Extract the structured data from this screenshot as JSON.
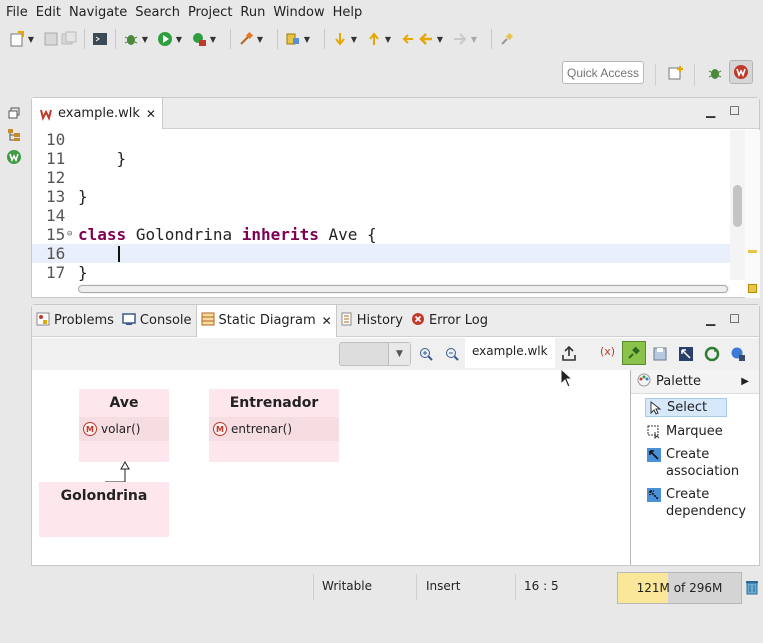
{
  "menu": [
    "File",
    "Edit",
    "Navigate",
    "Search",
    "Project",
    "Run",
    "Window",
    "Help"
  ],
  "toolbar": {
    "icons": [
      "new-icon",
      "save-icon",
      "save-all-icon",
      "terminal-icon",
      "debug-icon",
      "run-icon",
      "external-tools-icon",
      "hammer-icon",
      "open-type-icon",
      "next-annotation-icon",
      "prev-annotation-icon",
      "last-edit-icon",
      "back-icon",
      "forward-icon",
      "pin-icon"
    ]
  },
  "quick_access": {
    "placeholder": "Quick Access"
  },
  "editor": {
    "tab_title": "example.wlk",
    "lines": [
      {
        "num": "10",
        "text": ""
      },
      {
        "num": "11",
        "text": "    }"
      },
      {
        "num": "12",
        "text": ""
      },
      {
        "num": "13",
        "text": "}"
      },
      {
        "num": "14",
        "text": ""
      },
      {
        "num": "15",
        "text": "class Golondrina inherits Ave {"
      },
      {
        "num": "16",
        "text": ""
      },
      {
        "num": "17",
        "text": "}"
      }
    ],
    "keywords": [
      "class",
      "inherits"
    ]
  },
  "bottom": {
    "tabs": [
      {
        "label": "Problems",
        "icon": "problems-icon"
      },
      {
        "label": "Console",
        "icon": "console-icon"
      },
      {
        "label": "Static Diagram",
        "icon": "diagram-icon",
        "active": true
      },
      {
        "label": "History",
        "icon": "history-icon"
      },
      {
        "label": "Error Log",
        "icon": "error-log-icon"
      }
    ],
    "diagram_file": "example.wlk"
  },
  "diagram": {
    "classes": [
      {
        "name": "Ave",
        "methods": [
          "volar()"
        ]
      },
      {
        "name": "Entrenador",
        "methods": [
          "entrenar()"
        ]
      },
      {
        "name": "Golondrina",
        "methods": []
      }
    ]
  },
  "palette": {
    "title": "Palette",
    "items": [
      {
        "label": "Select",
        "icon": "select-arrow-icon"
      },
      {
        "label": "Marquee",
        "icon": "marquee-icon"
      },
      {
        "label": "Create\nassociation",
        "label_lines": [
          "Create",
          "association"
        ],
        "icon": "association-icon"
      },
      {
        "label": "Create\ndependency",
        "label_lines": [
          "Create",
          "dependency"
        ],
        "icon": "dependency-icon"
      }
    ]
  },
  "status": {
    "writable": "Writable",
    "insert": "Insert",
    "position": "16 : 5",
    "heap": "121M of 296M",
    "heap_used_fraction": 0.41
  },
  "colors": {
    "keyword": "#7f0055",
    "class_box": "#fde6ec",
    "heap_fill": "#fbe79a"
  }
}
